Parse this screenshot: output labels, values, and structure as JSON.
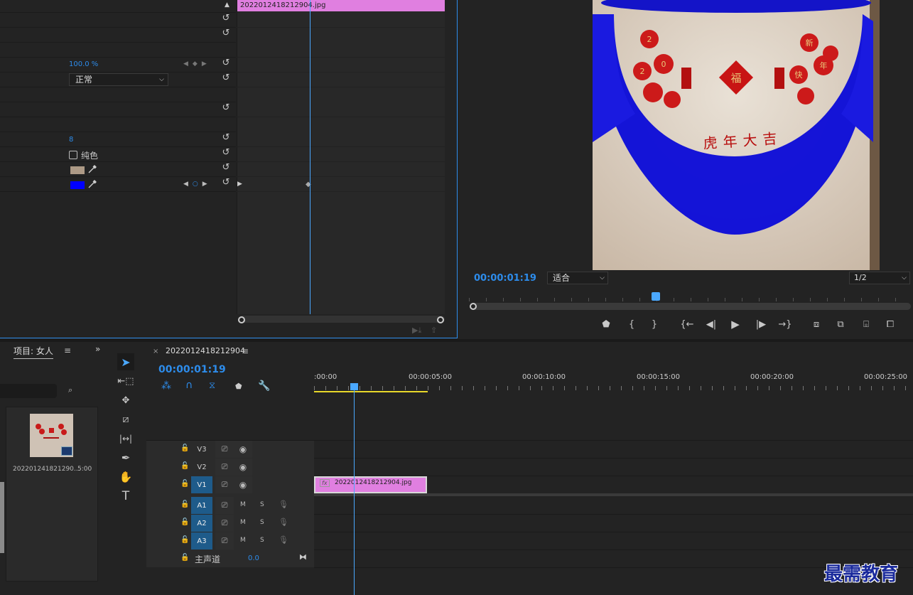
{
  "effect_controls": {
    "clip_tab": "2022012418212904.jpg",
    "opacity_value": "100.0 %",
    "blend_mode": "正常",
    "value_8": "8",
    "solid_label": "纯色",
    "color_1": "#ad9a86",
    "color_2": "#0000ff"
  },
  "program_monitor": {
    "timecode": "00:00:01:19",
    "fit_label": "适合",
    "resolution": "1/2",
    "image_text": "虎年大吉",
    "fu_text": "福"
  },
  "project": {
    "tab_label": "项目: 女人",
    "item_name": "202201241821290...",
    "item_duration": "5:00"
  },
  "sequence": {
    "name": "2022012418212904",
    "timecode": "00:00:01:19",
    "ruler_labels": [
      ":00:00",
      "00:00:05:00",
      "00:00:10:00",
      "00:00:15:00",
      "00:00:20:00",
      "00:00:25:00"
    ],
    "tracks_video": [
      "V3",
      "V2",
      "V1"
    ],
    "tracks_audio": [
      "A1",
      "A2",
      "A3"
    ],
    "mute_label": "M",
    "solo_label": "S",
    "master_label": "主声道",
    "master_value": "0.0",
    "clip_name": "2022012418212904.jpg",
    "clip_fx": "fx"
  },
  "watermark": "最需教育",
  "colors": {
    "accent": "#2d8ceb",
    "clip": "#e07fe0",
    "track_active": "#1e5b8a",
    "playhead": "#4aa8ff"
  }
}
